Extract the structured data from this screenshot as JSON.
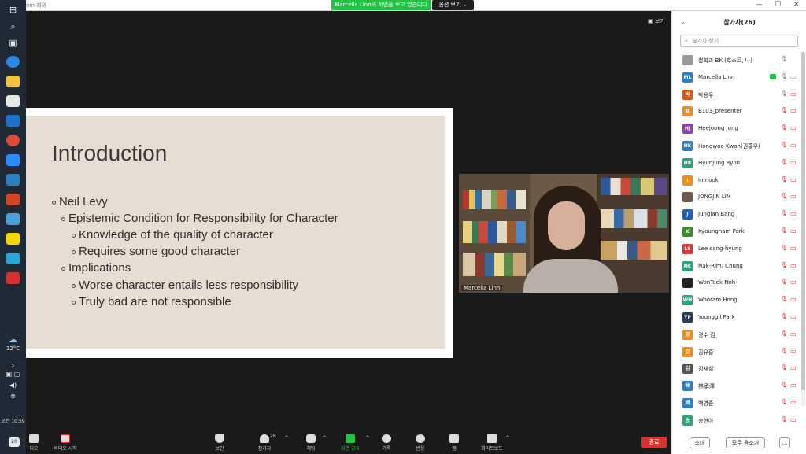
{
  "window": {
    "title": "om 회의",
    "share_banner": "Marcella Linn의 화면을 보고 있습니다",
    "view_options": "옵션 보기 ⌄",
    "controls": [
      "—",
      "☐",
      "✕"
    ]
  },
  "taskbar": {
    "weather": "12°C",
    "time": "오전 10:59",
    "badge": "20"
  },
  "meeting": {
    "view_label": "보기",
    "slide": {
      "title": "Introduction",
      "bullets": [
        "Neil Levy",
        "Epistemic Condition for Responsibility for Character",
        "Knowledge of the quality of character",
        "Requires some good character",
        "Implications",
        "Worse character entails less responsibility",
        "Truly bad are not responsible"
      ]
    },
    "video": {
      "name": "Marcella Linn"
    }
  },
  "toolbar": {
    "audio": "디오",
    "video": "비디오 시작",
    "security": "보안",
    "participants": "참가자",
    "participants_count": "26",
    "chat": "채팅",
    "share": "화면 공유",
    "record": "기록",
    "reactions": "반응",
    "apps": "앱",
    "whiteboard": "화이트보드",
    "end": "종료"
  },
  "panel": {
    "title": "참가자(26)",
    "search_placeholder": "참가자 찾기",
    "invite": "초대",
    "mute_all": "모두 음소거",
    "more": "...",
    "participants": [
      {
        "initials": "",
        "name": "철학과 BK (호스트, 나)",
        "color": "#9a9a9a",
        "mic": "on",
        "cam": "none"
      },
      {
        "initials": "ML",
        "name": "Marcella Linn",
        "color": "#2d7fc1",
        "mic": "on",
        "cam": "on",
        "sharing": true
      },
      {
        "initials": "박",
        "name": "박용우",
        "color": "#d4591b",
        "mic": "on",
        "cam": "off"
      },
      {
        "initials": "B",
        "name": "B103_presenter",
        "color": "#f08c1c",
        "mic": "off",
        "cam": "off"
      },
      {
        "initials": "HJ",
        "name": "Heejoong Jung",
        "color": "#8f3fb3",
        "mic": "off",
        "cam": "off"
      },
      {
        "initials": "HK",
        "name": "Hongwoo Kwon(권홍우)",
        "color": "#2d7fc1",
        "mic": "off",
        "cam": "off"
      },
      {
        "initials": "HR",
        "name": "Hyunjung Ryoo",
        "color": "#2aa57a",
        "mic": "off",
        "cam": "off"
      },
      {
        "initials": "I",
        "name": "inmook",
        "color": "#f08c1c",
        "mic": "off",
        "cam": "off"
      },
      {
        "initials": "",
        "name": "JONGJIN LIM",
        "color": "#6b5a4a",
        "mic": "off",
        "cam": "off"
      },
      {
        "initials": "J",
        "name": "Junglan Bang",
        "color": "#1d5fb0",
        "mic": "off",
        "cam": "off"
      },
      {
        "initials": "K",
        "name": "Kyoungnam Park",
        "color": "#3e8a2a",
        "mic": "off",
        "cam": "off"
      },
      {
        "initials": "LS",
        "name": "Lee sang-hyung",
        "color": "#d8383c",
        "mic": "off",
        "cam": "off"
      },
      {
        "initials": "NC",
        "name": "Nak-Rim, Chung",
        "color": "#2aa57a",
        "mic": "off",
        "cam": "off"
      },
      {
        "initials": "",
        "name": "WonTaek Noh",
        "color": "#222222",
        "mic": "off",
        "cam": "off"
      },
      {
        "initials": "WH",
        "name": "Wooram Hong",
        "color": "#2aa57a",
        "mic": "off",
        "cam": "off"
      },
      {
        "initials": "YP",
        "name": "Younggil Park",
        "color": "#2a3a5a",
        "mic": "off",
        "cam": "off"
      },
      {
        "initials": "경",
        "name": "경수 김",
        "color": "#f08c1c",
        "mic": "off",
        "cam": "off"
      },
      {
        "initials": "김",
        "name": "김유홍",
        "color": "#f08c1c",
        "mic": "off",
        "cam": "off"
      },
      {
        "initials": "김",
        "name": "김재철",
        "color": "#555555",
        "mic": "off",
        "cam": "off"
      },
      {
        "initials": "林",
        "name": "林承澤",
        "color": "#2d7fc1",
        "mic": "off",
        "cam": "off"
      },
      {
        "initials": "백",
        "name": "백영준",
        "color": "#2d7fc1",
        "mic": "off",
        "cam": "off"
      },
      {
        "initials": "송",
        "name": "송현아",
        "color": "#2aa57a",
        "mic": "off",
        "cam": "off"
      }
    ]
  }
}
